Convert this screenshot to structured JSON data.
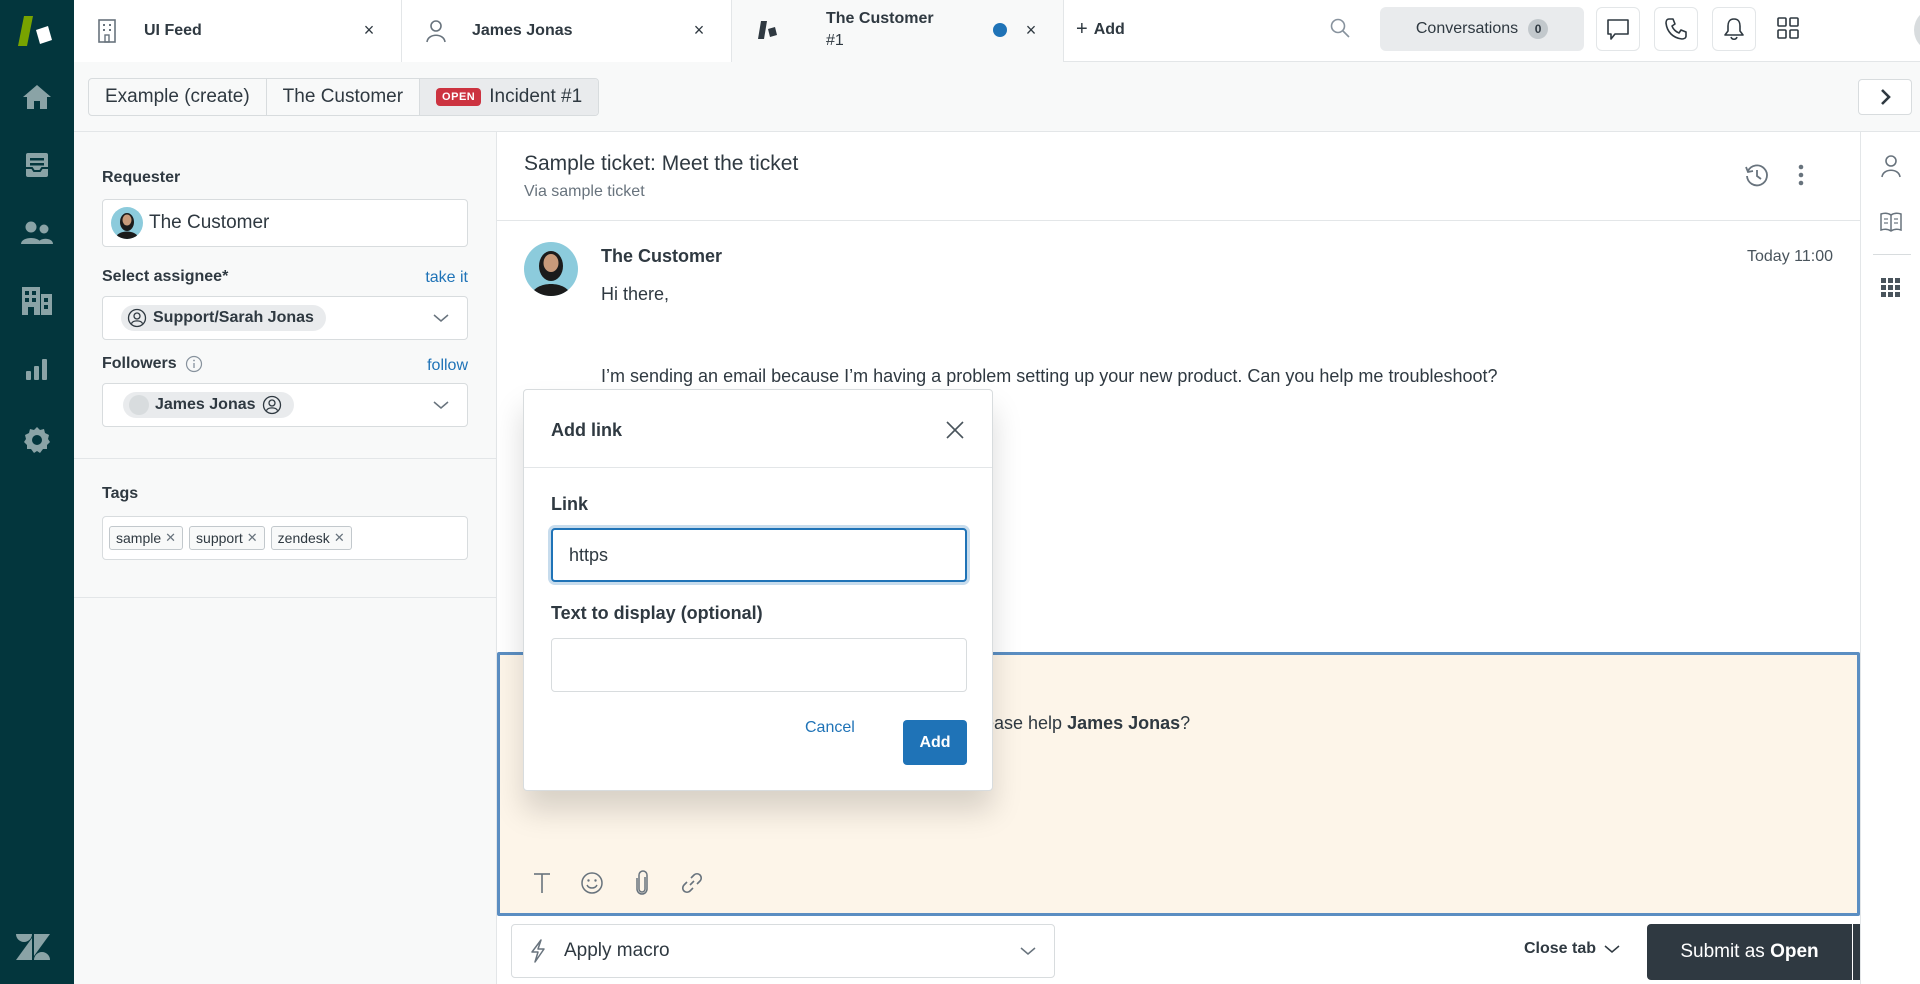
{
  "colors": {
    "nav_bg": "#03363d",
    "brand_green": "#78a300",
    "accent_blue": "#1f73b7",
    "open_badge": "#cc3340",
    "composer_bg": "#fdf5e9",
    "submit_bg": "#2f3941"
  },
  "nav": {
    "items": [
      {
        "icon": "home-icon",
        "label": "Home"
      },
      {
        "icon": "views-icon",
        "label": "Views"
      },
      {
        "icon": "customers-icon",
        "label": "Customers"
      },
      {
        "icon": "organizations-icon",
        "label": "Organizations"
      },
      {
        "icon": "reporting-icon",
        "label": "Reporting"
      },
      {
        "icon": "admin-gear-icon",
        "label": "Admin"
      }
    ]
  },
  "tabs": [
    {
      "label": "UI Feed",
      "icon": "organization-icon",
      "close": "×"
    },
    {
      "label": "James Jonas",
      "icon": "user-icon",
      "close": "×"
    },
    {
      "label_line1": "The Customer",
      "label_line2": "#1",
      "icon": "ticket-icon",
      "close": "×",
      "unsaved": true
    }
  ],
  "topbar": {
    "add_label": "Add",
    "conversations_label": "Conversations",
    "conversations_count": "0"
  },
  "breadcrumb": {
    "items": [
      "Example (create)",
      "The Customer",
      "Incident #1"
    ],
    "status_badge": "OPEN"
  },
  "properties": {
    "requester_label": "Requester",
    "requester_value": "The Customer",
    "assignee_label": "Select assignee*",
    "assignee_action": "take it",
    "assignee_value": "Support/Sarah Jonas",
    "followers_label": "Followers",
    "followers_action": "follow",
    "followers": [
      "James Jonas"
    ],
    "tags_label": "Tags",
    "tags": [
      "sample",
      "support",
      "zendesk"
    ]
  },
  "ticket": {
    "title": "Sample ticket: Meet the ticket",
    "via": "Via sample ticket",
    "message": {
      "author": "The Customer",
      "time": "Today 11:00",
      "greeting": "Hi there,",
      "body": "I’m sending an email because I’m having a problem setting up your new product. Can you help me troubleshoot?"
    },
    "composer": {
      "visible_prefix": "lease help ",
      "visible_name": "James Jonas",
      "visible_suffix": "?"
    }
  },
  "footer": {
    "macro_label": "Apply macro",
    "close_tab_label": "Close tab",
    "submit_prefix": "Submit as ",
    "submit_status": "Open"
  },
  "modal": {
    "title": "Add link",
    "link_label": "Link",
    "link_value": "https",
    "text_label": "Text to display (optional)",
    "text_value": "",
    "cancel_label": "Cancel",
    "add_label": "Add"
  }
}
